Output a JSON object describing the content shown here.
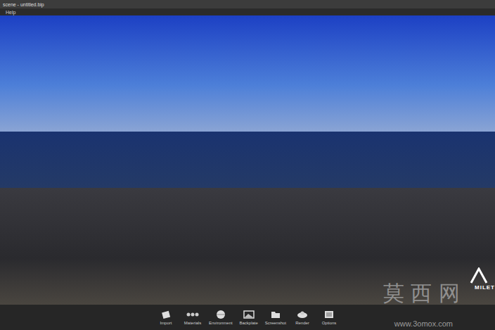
{
  "window": {
    "title": "scene - untitled.bip"
  },
  "menu": [
    "Help"
  ],
  "viewport": {
    "logo": "MILET"
  },
  "toolbar": [
    {
      "label": "Import",
      "kind": "import"
    },
    {
      "label": "Materials",
      "kind": "materials"
    },
    {
      "label": "Environment",
      "kind": "environment"
    },
    {
      "label": "Backplate",
      "kind": "backplate"
    },
    {
      "label": "Screenshot",
      "kind": "screenshot"
    },
    {
      "label": "Render",
      "kind": "render"
    },
    {
      "label": "Options",
      "kind": "options"
    }
  ],
  "watermark": {
    "title": "莫 西 网",
    "url": "www.3omox.com"
  }
}
